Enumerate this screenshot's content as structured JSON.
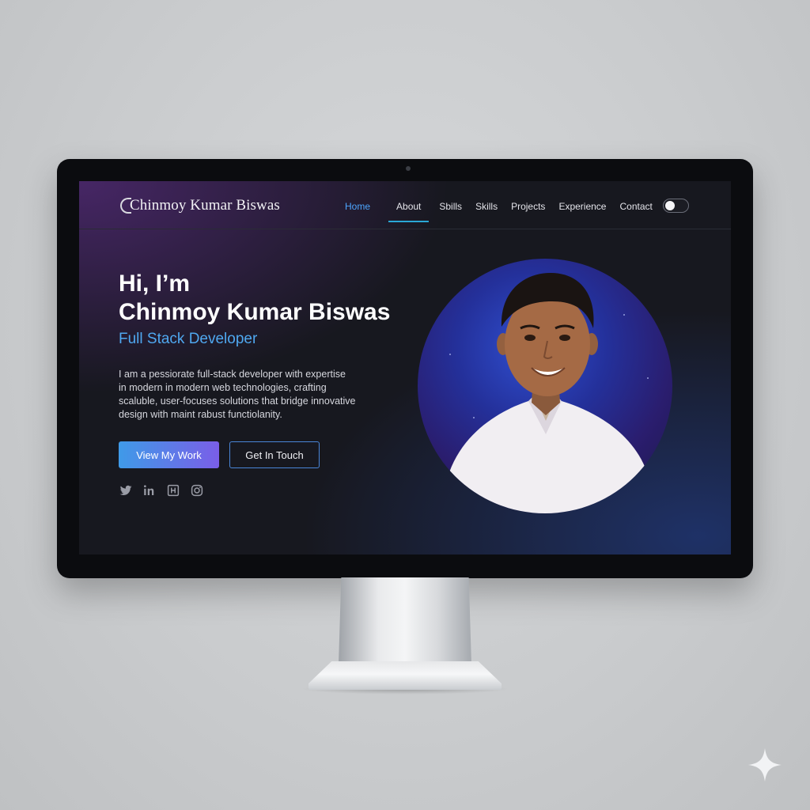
{
  "site": {
    "logo_text": "Chinmoy Kumar Biswas",
    "nav": [
      {
        "label": "Home",
        "active": true
      },
      {
        "label": "About",
        "active": false
      },
      {
        "label": "Sbills",
        "active": false
      },
      {
        "label": "Skills",
        "active": false
      },
      {
        "label": "Projects",
        "active": false
      },
      {
        "label": "Experience",
        "active": false
      },
      {
        "label": "Contact",
        "active": false
      }
    ],
    "theme_toggle": "theme-toggle"
  },
  "hero": {
    "greeting": "Hi, I’m",
    "name": "Chinmoy Kumar Biswas",
    "role": "Full Stack Developer",
    "description": "I am a pessiorate full-stack developer with expertise in modern in modern web technologies, crafting scaluble, user-focuses solutions that bridge innovative design with maint rabust functiolanity.",
    "primary_button": "View My Work",
    "secondary_button": "Get In Touch",
    "socials": [
      "twitter-icon",
      "linkedin-icon",
      "hackerrank-icon",
      "instagram-icon"
    ]
  },
  "colors": {
    "accent_blue": "#4da6ff",
    "accent_purple": "#7a5ee8",
    "screen_bg": "#17181f"
  }
}
